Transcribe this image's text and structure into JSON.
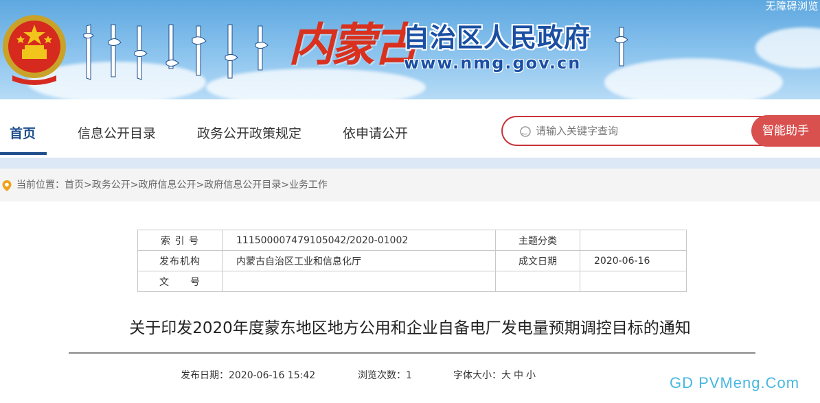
{
  "banner": {
    "accessibility_label": "无障碍浏览",
    "calligraphy": "内蒙古",
    "gov_name": "自治区人民政府",
    "url": "www.nmg.gov.cn"
  },
  "nav": {
    "items": [
      "首页",
      "信息公开目录",
      "政务公开政策规定",
      "依申请公开"
    ],
    "search_placeholder": "请输入关键字查询",
    "assistant_label": "智能助手"
  },
  "breadcrumb": {
    "prefix": "当前位置：",
    "items": [
      "首页",
      "政务公开",
      "政府信息公开",
      "政府信息公开目录",
      "业务工作"
    ],
    "separator": ">"
  },
  "info_table": {
    "rows": [
      {
        "label1": "索 引 号",
        "value1": "11150000747910504­2/2020-01002",
        "label2": "主题分类",
        "value2": ""
      },
      {
        "label1": "发布机构",
        "value1": "内蒙古自治区工业和信息化厅",
        "label2": "成文日期",
        "value2": "2020-06-16"
      },
      {
        "label1": "文　　号",
        "value1": "",
        "label2": "",
        "value2": ""
      }
    ]
  },
  "article": {
    "title": "关于印发2020年度蒙东地区地方公用和企业自备电厂发电量预期调控目标的通知",
    "publish_label": "发布日期：",
    "publish_value": "2020-06-16 15:42",
    "views_label": "浏览次数：",
    "views_value": "1",
    "font_label": "字体大小：",
    "font_options": [
      "大",
      "中",
      "小"
    ]
  },
  "watermark": "GD PVMeng.Com",
  "colors": {
    "nav_accent": "#1f4e8c",
    "search_border": "#c8323a",
    "assistant_bg": "#d9514f",
    "gov_name": "#1a4fa3",
    "calligraphy": "#d9311e"
  }
}
